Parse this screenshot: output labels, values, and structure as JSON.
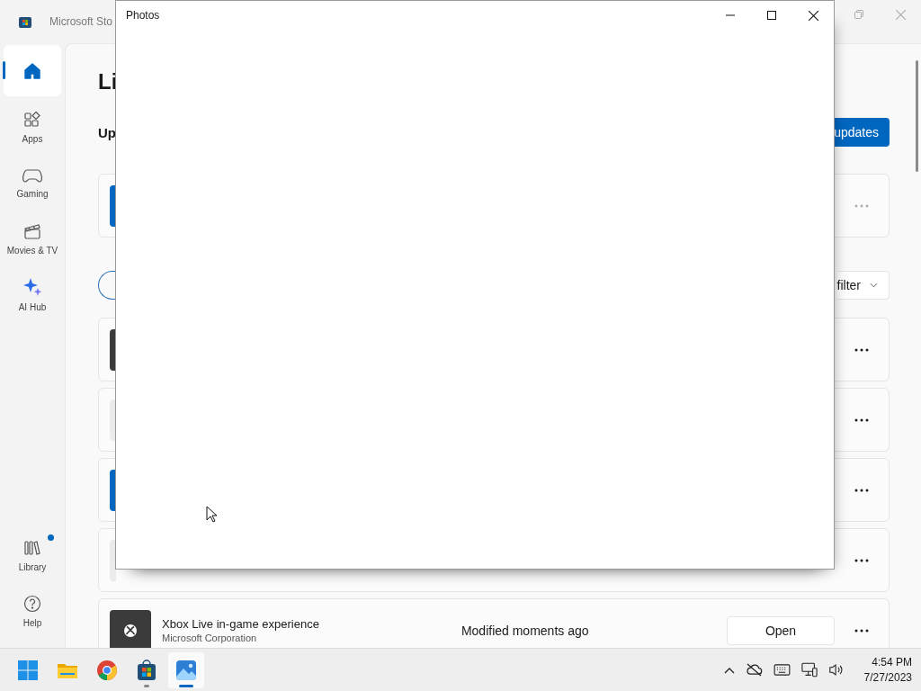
{
  "store_window": {
    "title": "Microsoft Sto",
    "sidebar": {
      "items": [
        {
          "kind": "home",
          "selected": true
        },
        {
          "kind": "apps",
          "label": "Apps",
          "selected": false
        },
        {
          "kind": "gaming",
          "label": "Gaming",
          "selected": false
        },
        {
          "kind": "movies",
          "label": "Movies & TV",
          "selected": false
        },
        {
          "kind": "ai",
          "label": "AI Hub",
          "selected": false
        }
      ],
      "footer_items": [
        {
          "kind": "library",
          "label": "Library",
          "selected": false,
          "notification": true
        },
        {
          "kind": "help",
          "label": "Help",
          "selected": false,
          "notification": false
        }
      ]
    },
    "library": {
      "heading": "Li",
      "updates_section": {
        "heading": "Up",
        "button": "updates",
        "card": {
          "color": "#0067c0",
          "more_disabled": true
        }
      },
      "filter_button": "filter",
      "apps": [
        {
          "color": "#3b3b3b"
        },
        {
          "color": "#ebebeb"
        },
        {
          "color": "#0067c0"
        },
        {
          "color": "#ebebeb"
        },
        {
          "color": "#3b3b3b",
          "kind": "xbox",
          "name": "Xbox Live in-game experience",
          "publisher": "Microsoft Corporation",
          "status": "Modified moments ago",
          "action": "Open"
        }
      ]
    }
  },
  "photos_window": {
    "title": "Photos"
  },
  "taskbar": {
    "apps": [
      {
        "kind": "start",
        "running": false,
        "selected": false
      },
      {
        "kind": "explorer",
        "running": false,
        "selected": false
      },
      {
        "kind": "chrome",
        "running": false,
        "selected": false
      },
      {
        "kind": "store",
        "running": true,
        "selected": false
      },
      {
        "kind": "photos",
        "running": true,
        "selected": true
      }
    ],
    "time": "4:54 PM",
    "date": "7/27/2023"
  }
}
